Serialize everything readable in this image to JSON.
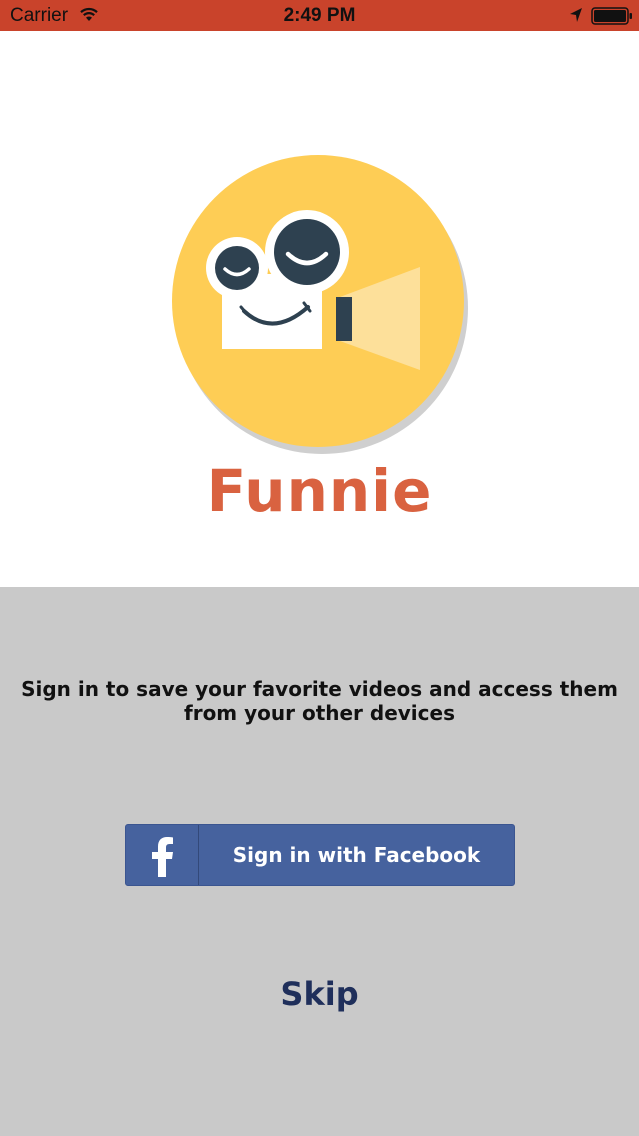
{
  "status_bar": {
    "carrier": "Carrier",
    "time": "2:49 PM",
    "icons": [
      "wifi-icon",
      "location-arrow-icon",
      "battery-icon"
    ],
    "color": "#c9432b"
  },
  "branding": {
    "logo_icon": "smiling-video-camera-logo",
    "app_name": "Funnie",
    "app_name_color": "#d96240",
    "logo_color": "#fecd55"
  },
  "signin": {
    "message": "Sign in to save your favorite videos and access them from your other devices",
    "facebook_button_label": "Sign in with Facebook",
    "facebook_icon": "facebook-f-icon",
    "facebook_color": "#46629e",
    "skip_label": "Skip",
    "skip_color": "#1f2f5b",
    "panel_color": "#c9c9c9"
  }
}
